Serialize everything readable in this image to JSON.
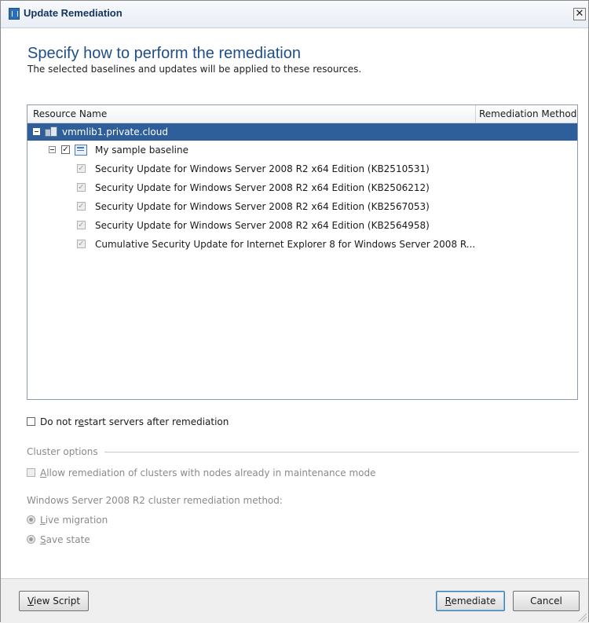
{
  "window": {
    "title": "Update Remediation",
    "close_glyph": "✕"
  },
  "header": {
    "heading": "Specify how to perform the remediation",
    "subheading": "The selected baselines and updates will be applied to these resources."
  },
  "grid": {
    "columns": [
      "Resource Name",
      "Remediation Method"
    ],
    "server": {
      "name": "vmmlib1.private.cloud",
      "icon": "server-icon",
      "selected": true
    },
    "baseline": {
      "name": "My sample baseline",
      "icon": "baseline-icon",
      "checked": true
    },
    "updates": [
      "Security Update for Windows Server 2008 R2 x64 Edition (KB2510531)",
      "Security Update for Windows Server 2008 R2 x64 Edition (KB2506212)",
      "Security Update for Windows Server 2008 R2 x64 Edition (KB2567053)",
      "Security Update for Windows Server 2008 R2 x64 Edition (KB2564958)",
      "Cumulative Security Update for Internet Explorer 8 for Windows Server 2008 R..."
    ]
  },
  "options": {
    "no_restart": {
      "pre": "Do not r",
      "accel": "e",
      "post": "start servers after remediation",
      "checked": false
    },
    "cluster_group": "Cluster options",
    "allow_maintenance": {
      "accel": "A",
      "post": "llow remediation of clusters with nodes already in maintenance mode",
      "checked": false,
      "enabled": false
    },
    "method_label": "Windows Server 2008 R2 cluster remediation method:",
    "live_migration": {
      "accel": "L",
      "post": "ive migration",
      "enabled": false
    },
    "save_state": {
      "accel": "S",
      "post": "ave state",
      "enabled": false
    }
  },
  "buttons": {
    "view_script": {
      "accel": "V",
      "post": "iew Script"
    },
    "remediate": {
      "accel": "R",
      "post": "emediate"
    },
    "cancel": "Cancel"
  }
}
